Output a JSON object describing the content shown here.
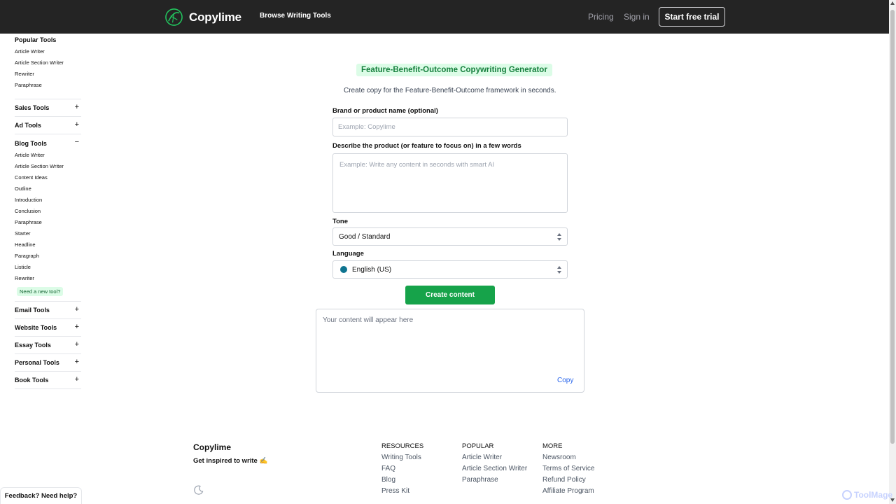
{
  "header": {
    "brand": "Copylime",
    "browse": "Browse Writing Tools",
    "pricing": "Pricing",
    "signin": "Sign in",
    "trial": "Start free trial"
  },
  "sidebar": {
    "popular_heading": "Popular Tools",
    "popular_items": [
      "Article Writer",
      "Article Section Writer",
      "Rewriter",
      "Paraphrase"
    ],
    "categories_top": [
      {
        "label": "Sales Tools",
        "sign": "+"
      },
      {
        "label": "Ad Tools",
        "sign": "+"
      },
      {
        "label": "Blog Tools",
        "sign": "−"
      }
    ],
    "blog_items": [
      "Article Writer",
      "Article Section Writer",
      "Content Ideas",
      "Outline",
      "Introduction",
      "Conclusion",
      "Paraphrase",
      "Starter",
      "Headline",
      "Paragraph",
      "Listicle",
      "Rewriter"
    ],
    "need_tool": "Need a new tool?",
    "categories_bottom": [
      {
        "label": "Email Tools",
        "sign": "+"
      },
      {
        "label": "Website Tools",
        "sign": "+"
      },
      {
        "label": "Essay Tools",
        "sign": "+"
      },
      {
        "label": "Personal Tools",
        "sign": "+"
      },
      {
        "label": "Book Tools",
        "sign": "+"
      }
    ]
  },
  "main": {
    "title": "Feature-Benefit-Outcome Copywriting Generator",
    "subtitle": "Create copy for the Feature-Benefit-Outcome framework in seconds.",
    "brand_label": "Brand or product name (optional)",
    "brand_placeholder": "Example: Copylime",
    "desc_label": "Describe the product (or feature to focus on) in a few words",
    "desc_placeholder": "Example: Write any content in seconds with smart AI",
    "tone_label": "Tone",
    "tone_value": "Good / Standard",
    "language_label": "Language",
    "language_value": "English (US)",
    "create_button": "Create content",
    "output_placeholder": "Your content will appear here",
    "copy": "Copy"
  },
  "footer": {
    "brand": "Copylime",
    "tagline": "Get inspired to write ✍️",
    "columns": [
      {
        "title": "RESOURCES",
        "links": [
          "Writing Tools",
          "FAQ",
          "Blog",
          "Press Kit"
        ]
      },
      {
        "title": "POPULAR",
        "links": [
          "Article Writer",
          "Article Section Writer",
          "Paraphrase"
        ]
      },
      {
        "title": "MORE",
        "links": [
          "Newsroom",
          "Terms of Service",
          "Refund Policy",
          "Affiliate Program"
        ]
      }
    ],
    "feedback": "Feedback? Need help?",
    "watermark": "ToolMage"
  },
  "colors": {
    "header_bg": "#242424",
    "accent_green": "#16a34a",
    "badge_bg": "#dcfce7",
    "link_blue": "#2563eb"
  }
}
